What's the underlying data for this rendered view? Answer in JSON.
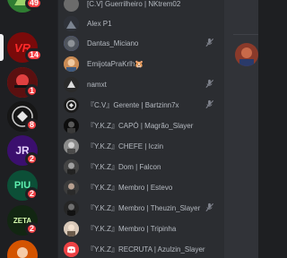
{
  "servers": [
    {
      "name_label": "",
      "badge": "49",
      "bg": "#2f7d32"
    },
    {
      "name_label": "VR",
      "badge": "14",
      "bg": "#8b0000",
      "selected": true
    },
    {
      "name_label": "",
      "badge": "1",
      "bg": "#6e1515"
    },
    {
      "name_label": "",
      "badge": "8",
      "bg": "#111111"
    },
    {
      "name_label": "JR",
      "badge": "2",
      "bg": "#5b21b6"
    },
    {
      "name_label": "PIU",
      "badge": "2",
      "bg": "#0f6b4a"
    },
    {
      "name_label": "ZETA",
      "badge": "2",
      "bg": "#1a3a1a"
    },
    {
      "name_label": "",
      "badge": "",
      "bg": "#c0392b"
    }
  ],
  "members": [
    {
      "name": "[C.V] Guerrilheiro | NKtrem02",
      "avatar_color": "#6b6b6b",
      "muted": false
    },
    {
      "name": "Alex P1",
      "avatar_color": "#3a3f4b",
      "muted": false
    },
    {
      "name": "Dantas_Miciano",
      "avatar_color": "#5865f2",
      "muted": true
    },
    {
      "name": "EmijotaPraKrlh🐹",
      "avatar_color": "#d08a4a",
      "muted": false
    },
    {
      "name": "namxt",
      "avatar_color": "#2d2d2d",
      "muted": true
    },
    {
      "name": "『C.V』Gerente | Bartzinn7x",
      "avatar_color": "#3b3b3b",
      "muted": true
    },
    {
      "name": "『Y.K.Z』CAPÓ | Magrão_Slayer",
      "avatar_color": "#111111",
      "muted": false
    },
    {
      "name": "『Y.K.Z』CHEFE | Iczin",
      "avatar_color": "#7a7a7a",
      "muted": false
    },
    {
      "name": "『Y.K.Z』Dom | Falcon",
      "avatar_color": "#555555",
      "muted": false
    },
    {
      "name": "『Y.K.Z』Membro | Estevo",
      "avatar_color": "#4a4a4a",
      "muted": false
    },
    {
      "name": "『Y.K.Z』Membro | Theuzin_Slayer",
      "avatar_color": "#2e2e2e",
      "muted": true
    },
    {
      "name": "『Y.K.Z』Membro | Tripinha",
      "avatar_color": "#c8b8a8",
      "muted": false
    },
    {
      "name": "『Y.K.Z』RECRUTA | Azulzin_Slayer",
      "avatar_color": "#ed4245",
      "muted": false
    }
  ],
  "colors": {
    "rail_bg": "#1e1f22",
    "members_bg": "#2b2d31",
    "content_bg": "#313338",
    "badge_red": "#f23f43",
    "name_gray": "#b5bac1"
  }
}
